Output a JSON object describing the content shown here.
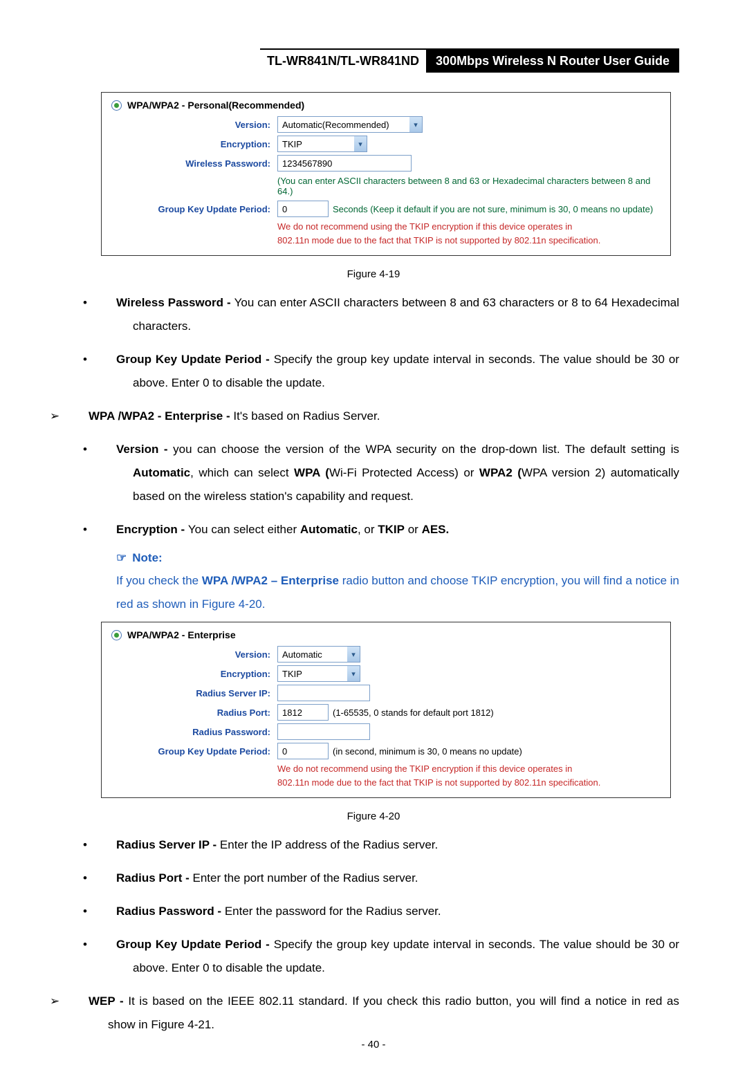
{
  "header": {
    "left": "TL-WR841N/TL-WR841ND",
    "right": "300Mbps Wireless N Router User Guide"
  },
  "panel1": {
    "radio_title": "WPA/WPA2 - Personal(Recommended)",
    "version_label": "Version:",
    "version_value": "Automatic(Recommended)",
    "encryption_label": "Encryption:",
    "encryption_value": "TKIP",
    "pwd_label": "Wireless Password:",
    "pwd_value": "1234567890",
    "pwd_hint": "(You can enter ASCII characters between 8 and 63 or Hexadecimal characters between 8 and 64.)",
    "gkp_label": "Group Key Update Period:",
    "gkp_value": "0",
    "gkp_hint": "Seconds (Keep it default if you are not sure, minimum is 30, 0 means no update)",
    "warn1": "We do not recommend using the TKIP encryption if this device operates in",
    "warn2": "802.11n mode due to the fact that TKIP is not supported by 802.11n specification."
  },
  "figcap1": "Figure 4-19",
  "bullets": {
    "wp_label": "Wireless Password - ",
    "wp_text": "You can enter ASCII characters between 8 and 63 characters or 8 to 64 Hexadecimal characters.",
    "gk_label": "Group Key Update Period - ",
    "gk_text": "Specify the group key update interval in seconds. The value should be 30 or above. Enter 0 to disable the update.",
    "ent_label": "WPA /WPA2 - Enterprise - ",
    "ent_text": "It's based on Radius Server.",
    "ver_label": "Version  - ",
    "ver_text_a": "you can choose the version of the WPA security on the drop-down list. The default setting is ",
    "ver_auto": "Automatic",
    "ver_text_b": ", which can select ",
    "ver_wpa": "WPA (",
    "ver_text_c": "Wi-Fi Protected Access) or ",
    "ver_wpa2": "WPA2 (",
    "ver_text_d": "WPA version 2) automatically based on the wireless station's capability and request.",
    "enc_label": "Encryption - ",
    "enc_text_a": " You can select either ",
    "enc_auto": "Automatic",
    "enc_or": ", or ",
    "enc_tkip": "TKIP",
    "enc_or2": " or ",
    "enc_aes": "AES."
  },
  "note": {
    "hdr": "Note:",
    "body_a": "If you check the ",
    "body_b": "WPA /WPA2 – Enterprise",
    "body_c": " radio button and choose TKIP encryption, you will find a notice in red as shown in Figure 4-20."
  },
  "panel2": {
    "radio_title": "WPA/WPA2 - Enterprise",
    "version_label": "Version:",
    "version_value": "Automatic",
    "encryption_label": "Encryption:",
    "encryption_value": "TKIP",
    "rsip_label": "Radius Server IP:",
    "rsip_value": "",
    "rport_label": "Radius Port:",
    "rport_value": "1812",
    "rport_hint": "(1-65535, 0 stands for default port 1812)",
    "rpwd_label": "Radius Password:",
    "rpwd_value": "",
    "gkp_label": "Group Key Update Period:",
    "gkp_value": "0",
    "gkp_hint": "(in second, minimum is 30, 0 means no update)",
    "warn1": "We do not recommend using the TKIP encryption if this device operates in",
    "warn2": "802.11n mode due to the fact that TKIP is not supported by 802.11n specification."
  },
  "figcap2": "Figure 4-20",
  "bullets2": {
    "rip_label": "Radius Server IP - ",
    "rip_text": "Enter the IP address of the Radius server.",
    "rport_label": "Radius Port - ",
    "rport_text": "Enter the port number of the Radius server.",
    "rpwd_label": "Radius Password - ",
    "rpwd_text": "Enter the password for the Radius server.",
    "gk_label": "Group Key Update Period - ",
    "gk_text": "Specify the group key update interval in seconds. The value should be 30 or above. Enter 0 to disable the update.",
    "wep_label": "WEP - ",
    "wep_text": "It is based on the IEEE 802.11 standard. If you check this radio button, you will find a notice in red as show in Figure 4-21."
  },
  "page_num": "- 40 -",
  "chart_data": {
    "type": "table",
    "tables": [
      {
        "title": "WPA/WPA2 - Personal(Recommended)",
        "rows": [
          [
            "Version",
            "Automatic(Recommended)"
          ],
          [
            "Encryption",
            "TKIP"
          ],
          [
            "Wireless Password",
            "1234567890"
          ],
          [
            "Group Key Update Period",
            "0"
          ]
        ]
      },
      {
        "title": "WPA/WPA2 - Enterprise",
        "rows": [
          [
            "Version",
            "Automatic"
          ],
          [
            "Encryption",
            "TKIP"
          ],
          [
            "Radius Server IP",
            ""
          ],
          [
            "Radius Port",
            "1812"
          ],
          [
            "Radius Password",
            ""
          ],
          [
            "Group Key Update Period",
            "0"
          ]
        ]
      }
    ]
  }
}
